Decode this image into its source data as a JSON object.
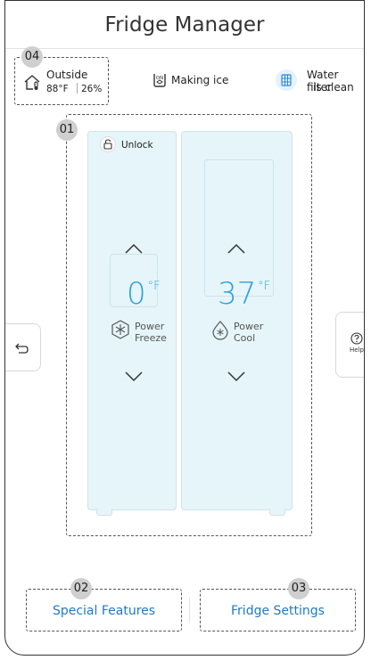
{
  "app": {
    "title": "Fridge Manager"
  },
  "callouts": {
    "fridge": "01",
    "special": "02",
    "settings": "03",
    "outside": "04"
  },
  "status": {
    "outside_label": "Outside",
    "outside_temp": "88°F",
    "outside_humidity": "26%",
    "ice_label": "Making ice",
    "filter_line1": "Water filter",
    "filter_line2": "is clean"
  },
  "lock": {
    "label": "Unlock"
  },
  "freezer": {
    "temp": "0",
    "unit": "°F",
    "mode_line1": "Power",
    "mode_line2": "Freeze"
  },
  "fridge": {
    "temp": "37",
    "unit": "°F",
    "mode_line1": "Power",
    "mode_line2": "Cool"
  },
  "side": {
    "help_label": "Help"
  },
  "bottom": {
    "special_features": "Special Features",
    "fridge_settings": "Fridge Settings"
  },
  "colors": {
    "accent": "#2aa0de",
    "link": "#1f7ac3",
    "door": "#e6f5f9"
  },
  "icons": {
    "outside": "house-thermometer-icon",
    "ice": "ice-maker-icon",
    "filter": "water-filter-icon",
    "lock": "lock-icon",
    "freeze": "snowflake-icon",
    "cool": "water-drop-icon",
    "back": "back-arrow-icon",
    "help": "help-icon"
  }
}
